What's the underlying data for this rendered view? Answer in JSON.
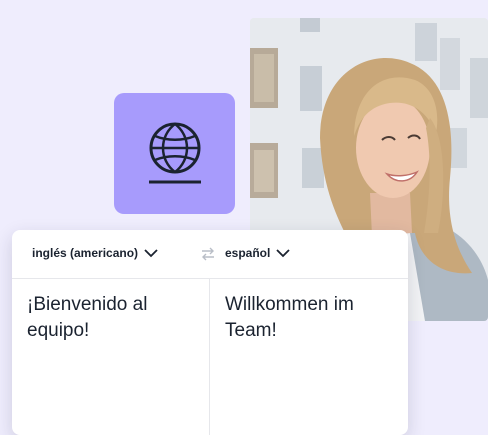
{
  "translator": {
    "source_language": "inglés (americano)",
    "target_language": "español",
    "source_text": "¡Bienvenido al equipo!",
    "target_text": "Willkommen im Team!"
  },
  "icons": {
    "globe": "globe-icon",
    "swap": "swap-arrows-icon",
    "dropdown": "chevron-down-icon"
  },
  "colors": {
    "background": "#efedfd",
    "accent": "#a79bfc",
    "text": "#1b2330"
  }
}
